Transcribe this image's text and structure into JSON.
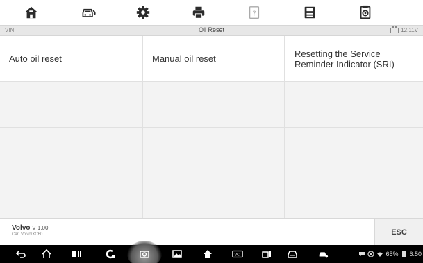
{
  "toolbar": {
    "items": [
      {
        "icon": "home-icon"
      },
      {
        "icon": "vehicle-swap-icon"
      },
      {
        "icon": "settings-gear-icon"
      },
      {
        "icon": "print-icon"
      },
      {
        "icon": "help-icon"
      },
      {
        "icon": "save-icon"
      },
      {
        "icon": "data-logging-icon"
      }
    ]
  },
  "titlebar": {
    "vin_label": "VIN:",
    "title": "Oil Reset",
    "battery_voltage": "12.11V"
  },
  "menu": {
    "cells": [
      "Auto oil reset",
      "Manual oil reset",
      "Resetting the Service Reminder Indicator (SRI)",
      "",
      "",
      "",
      "",
      "",
      "",
      "",
      "",
      ""
    ]
  },
  "footer": {
    "make": "Volvo",
    "version": "V 1.00",
    "car": "Car: Volvo/XC60",
    "esc_label": "ESC"
  },
  "navbar": {
    "battery_percent": "65%",
    "time": "6:50"
  },
  "colors": {
    "toolbar_icon": "#2b2b2b",
    "titlebar_bg": "#e7e7e7",
    "grid_bg": "#f3f3f3",
    "navbar_bg": "#000000"
  }
}
